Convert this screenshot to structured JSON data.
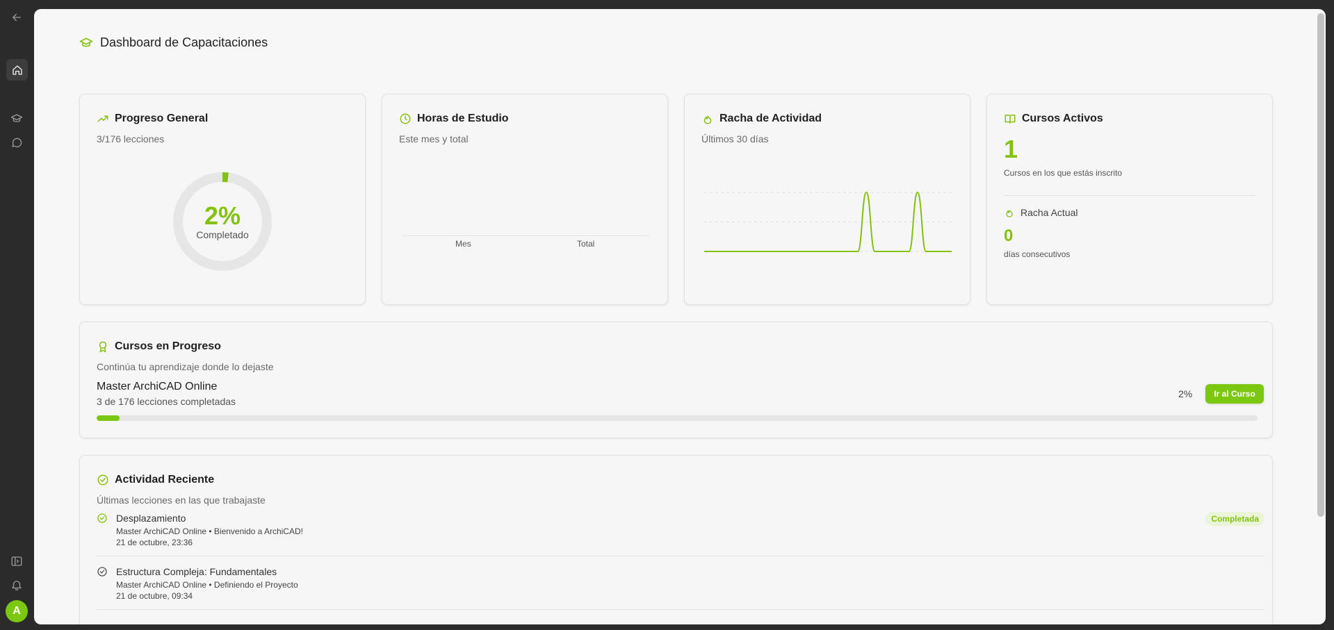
{
  "app": {
    "page_title": "Dashboard de Capacitaciones",
    "avatar_initial": "A"
  },
  "colors": {
    "accent": "#84c20f",
    "accent_fill": "#7cc70f",
    "rail_bg": "#2b2b2b",
    "page_bg": "#f7f7f7"
  },
  "sidebar": {
    "icons": [
      "back-arrow-icon",
      "home-icon",
      "graduation-cap-icon",
      "chat-bubble-icon",
      "panel-toggle-icon",
      "bell-icon"
    ],
    "active": "home-icon"
  },
  "cards": {
    "progress": {
      "title": "Progreso General",
      "subtitle": "3/176 lecciones",
      "percent_text": "2%",
      "percent_value": 2,
      "percent_label": "Completado"
    },
    "hours": {
      "title": "Horas de Estudio",
      "subtitle": "Este mes y total",
      "bar_labels": [
        "Mes",
        "Total"
      ]
    },
    "streak": {
      "title": "Racha de Actividad",
      "subtitle": "Últimos 30 días"
    },
    "active_courses": {
      "title": "Cursos Activos",
      "count": "1",
      "count_label": "Cursos en los que estás inscrito",
      "streak_title": "Racha Actual",
      "streak_value": "0",
      "streak_label": "días consecutivos"
    }
  },
  "chart_data": {
    "type": "line",
    "x": [
      1,
      2,
      3,
      4,
      5,
      6,
      7,
      8,
      9,
      10,
      11,
      12,
      13,
      14,
      15,
      16,
      17,
      18,
      19,
      20,
      21,
      22,
      23,
      24,
      25,
      26,
      27,
      28,
      29,
      30
    ],
    "series": [
      {
        "values": [
          0,
          0,
          0,
          0,
          0,
          0,
          0,
          0,
          0,
          0,
          0,
          0,
          0,
          0,
          0,
          0,
          0,
          0,
          0,
          1,
          0,
          0,
          0,
          0,
          0,
          1,
          0,
          0,
          0,
          0
        ]
      }
    ],
    "ylim": [
      0,
      1
    ],
    "grid": true
  },
  "in_progress": {
    "title": "Cursos en Progreso",
    "subtitle": "Continúa tu aprendizaje donde lo dejaste",
    "course_name": "Master ArchiCAD Online",
    "course_detail": "3 de 176 lecciones completadas",
    "percent_text": "2%",
    "percent_value": 2,
    "button_label": "Ir al Curso"
  },
  "recent": {
    "title": "Actividad Reciente",
    "subtitle": "Últimas lecciones en las que trabajaste",
    "items": [
      {
        "title": "Desplazamiento",
        "meta": "Master ArchiCAD Online • Bienvenido a ArchiCAD!",
        "time": "21 de octubre, 23:36",
        "status": "Completada"
      },
      {
        "title": "Estructura Compleja: Fundamentales",
        "meta": "Master ArchiCAD Online • Definiendo el Proyecto",
        "time": "21 de octubre, 09:34",
        "status": ""
      }
    ]
  }
}
